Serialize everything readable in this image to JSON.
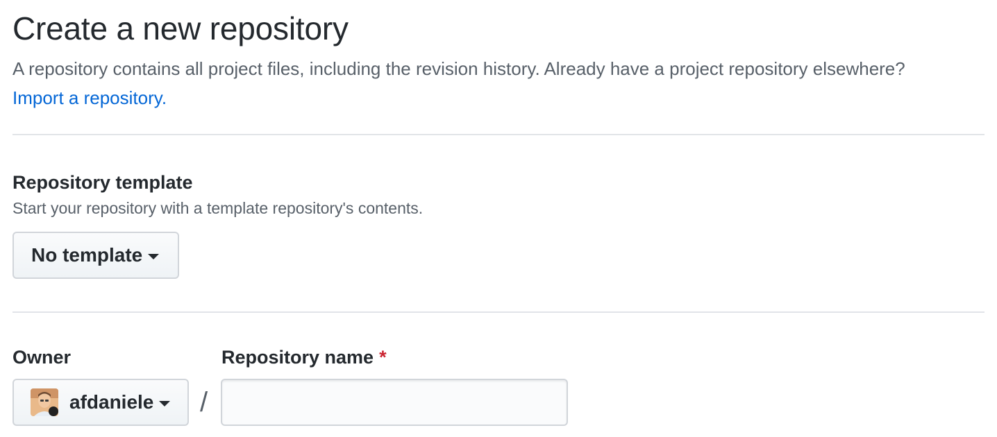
{
  "header": {
    "title": "Create a new repository",
    "subtitle": "A repository contains all project files, including the revision history. Already have a project repository elsewhere?",
    "import_link": "Import a repository."
  },
  "template_section": {
    "heading": "Repository template",
    "description": "Start your repository with a template repository's contents.",
    "selected_template": "No template"
  },
  "owner_section": {
    "label": "Owner",
    "selected_owner": "afdaniele",
    "avatar_icon": "user-avatar"
  },
  "repo_name": {
    "label": "Repository name",
    "required_marker": "*",
    "value": "",
    "separator": "/"
  },
  "colors": {
    "link": "#0366d6",
    "required": "#cb2431",
    "muted_text": "#586069",
    "border": "#d1d5da"
  }
}
